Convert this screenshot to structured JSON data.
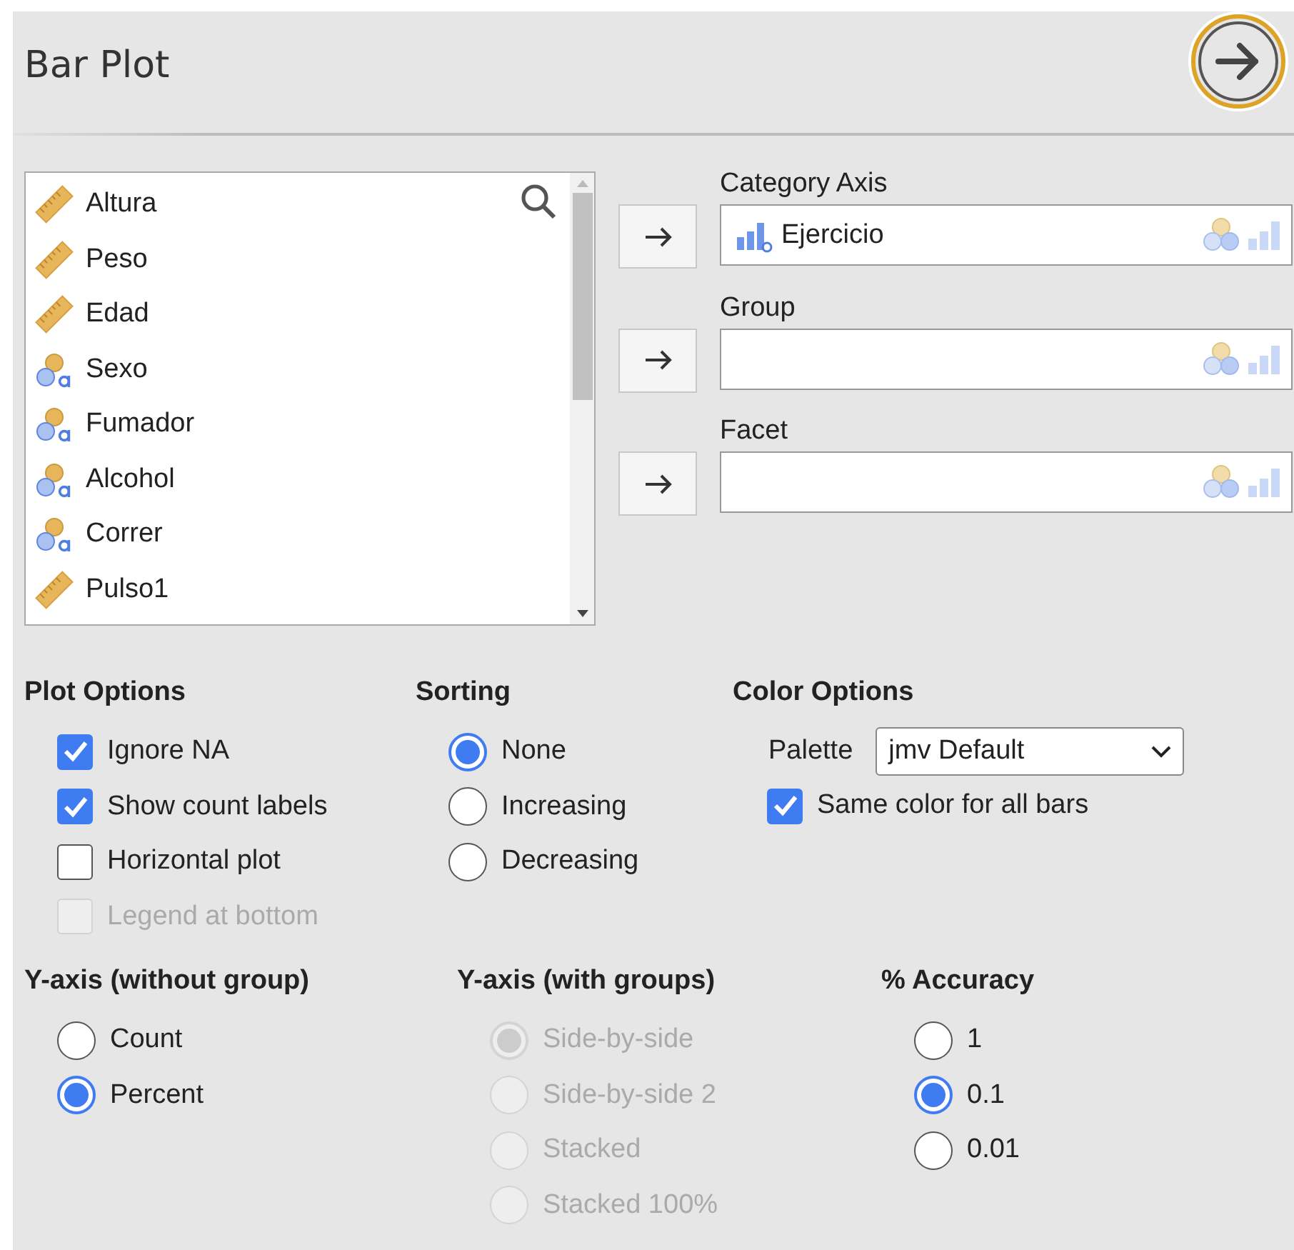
{
  "header": {
    "title": "Bar Plot"
  },
  "variables": [
    {
      "name": "Altura",
      "kind": "continuous"
    },
    {
      "name": "Peso",
      "kind": "continuous"
    },
    {
      "name": "Edad",
      "kind": "continuous"
    },
    {
      "name": "Sexo",
      "kind": "nominal"
    },
    {
      "name": "Fumador",
      "kind": "nominal"
    },
    {
      "name": "Alcohol",
      "kind": "nominal"
    },
    {
      "name": "Correr",
      "kind": "nominal"
    },
    {
      "name": "Pulso1",
      "kind": "continuous"
    }
  ],
  "targets": [
    {
      "label": "Category Axis",
      "variables": [
        {
          "name": "Ejercicio",
          "kind": "ordinal"
        }
      ]
    },
    {
      "label": "Group"
    },
    {
      "label": "Facet"
    }
  ],
  "options_top": [
    {
      "heading": "Plot Options",
      "kind": "checkbox",
      "items": [
        {
          "label": "Ignore NA",
          "checked": true,
          "disabled": false
        },
        {
          "label": "Show count labels",
          "checked": true,
          "disabled": false
        },
        {
          "label": "Horizontal plot",
          "checked": false,
          "disabled": false
        },
        {
          "label": "Legend at bottom",
          "checked": false,
          "disabled": true
        }
      ]
    },
    {
      "heading": "Sorting",
      "kind": "radio",
      "items": [
        {
          "label": "None",
          "selected": true,
          "disabled": false
        },
        {
          "label": "Increasing",
          "selected": false,
          "disabled": false
        },
        {
          "label": "Decreasing",
          "selected": false,
          "disabled": false
        }
      ]
    },
    {
      "heading": "Color Options",
      "kind": "color",
      "palette_label": "Palette",
      "palette_value": "jmv Default",
      "items": [
        {
          "label": "Same color for all bars",
          "checked": true,
          "disabled": false
        }
      ]
    }
  ],
  "options_bottom": [
    {
      "heading": "Y-axis (without group)",
      "kind": "radio",
      "items": [
        {
          "label": "Count",
          "selected": false,
          "disabled": false
        },
        {
          "label": "Percent",
          "selected": true,
          "disabled": false
        }
      ]
    },
    {
      "heading": "Y-axis (with groups)",
      "kind": "radio",
      "items": [
        {
          "label": "Side-by-side",
          "selected": true,
          "disabled": true
        },
        {
          "label": "Side-by-side 2",
          "selected": false,
          "disabled": true
        },
        {
          "label": "Stacked",
          "selected": false,
          "disabled": true
        },
        {
          "label": "Stacked 100%",
          "selected": false,
          "disabled": true
        }
      ]
    },
    {
      "heading": "% Accuracy",
      "kind": "radio",
      "items": [
        {
          "label": "1",
          "selected": false,
          "disabled": false
        },
        {
          "label": "0.1",
          "selected": true,
          "disabled": false
        },
        {
          "label": "0.01",
          "selected": false,
          "disabled": false
        }
      ]
    }
  ]
}
